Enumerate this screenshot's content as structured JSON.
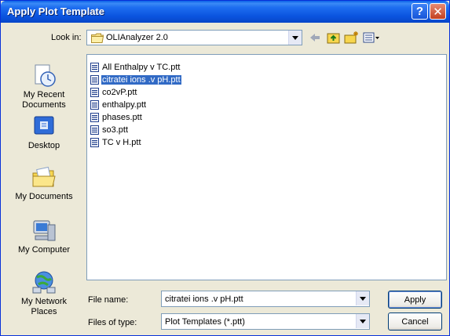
{
  "window": {
    "title": "Apply Plot Template",
    "help_glyph": "?",
    "close_glyph": "✕"
  },
  "lookin": {
    "label": "Look in:",
    "value": "OLIAnalyzer 2.0"
  },
  "places": [
    {
      "label": "My Recent Documents",
      "icon": "recent-documents-icon"
    },
    {
      "label": "Desktop",
      "icon": "desktop-icon"
    },
    {
      "label": "My Documents",
      "icon": "my-documents-icon"
    },
    {
      "label": "My Computer",
      "icon": "my-computer-icon"
    },
    {
      "label": "My Network Places",
      "icon": "network-places-icon"
    }
  ],
  "files": [
    {
      "label": "All Enthalpy v TC.ptt",
      "selected": false
    },
    {
      "label": "citratei ions .v pH.ptt",
      "selected": true
    },
    {
      "label": "co2vP.ptt",
      "selected": false
    },
    {
      "label": "enthalpy.ptt",
      "selected": false
    },
    {
      "label": "phases.ptt",
      "selected": false
    },
    {
      "label": "so3.ptt",
      "selected": false
    },
    {
      "label": "TC v H.ptt",
      "selected": false
    }
  ],
  "file_name": {
    "label": "File name:",
    "value": "citratei ions .v pH.ptt"
  },
  "file_type": {
    "label": "Files of type:",
    "value": "Plot Templates (*.ptt)"
  },
  "buttons": {
    "apply": "Apply",
    "cancel": "Cancel"
  },
  "colors": {
    "titlebar": "#0B54DF",
    "selection": "#316AC5",
    "dialog_bg": "#ECE9D8"
  }
}
